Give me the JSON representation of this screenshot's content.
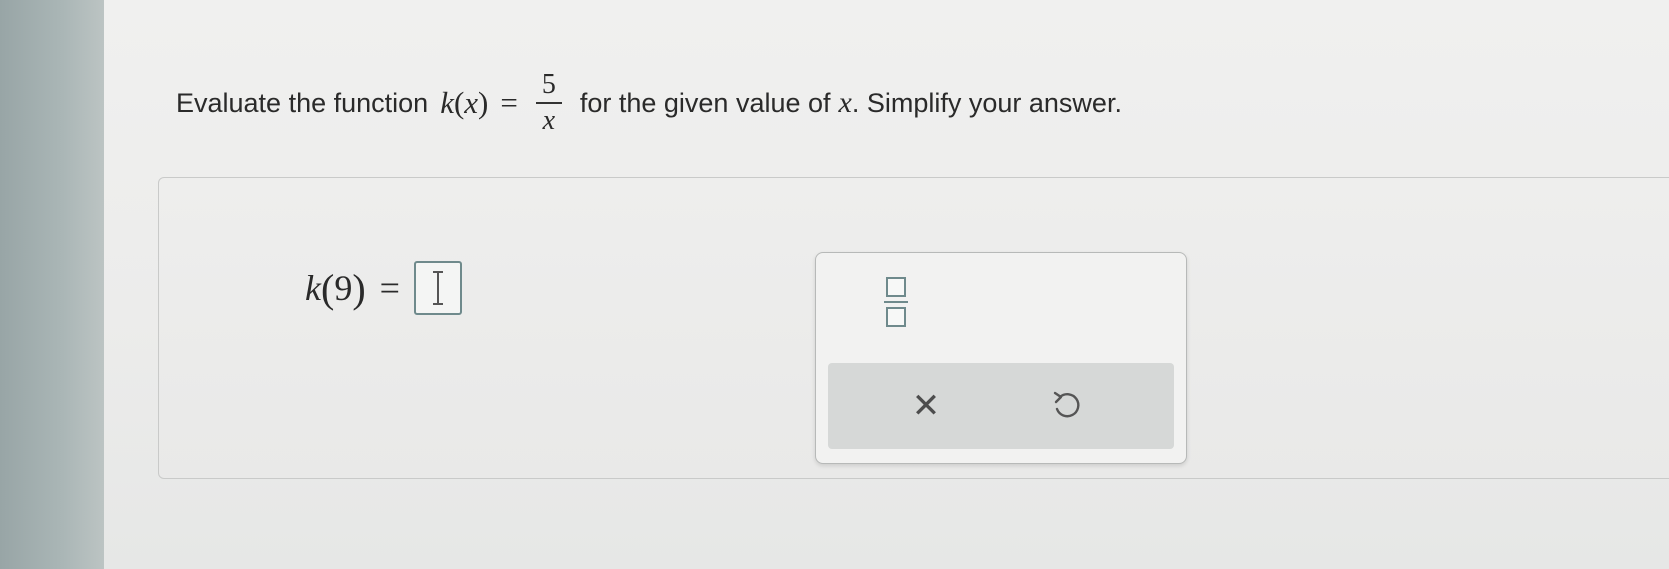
{
  "question": {
    "intro": "Evaluate the function",
    "func_name": "k",
    "func_var": "x",
    "numerator": "5",
    "denominator": "x",
    "middle": "for the given value of",
    "var": "x",
    "end": ". Simplify your answer."
  },
  "answer": {
    "func_name": "k",
    "arg": "9",
    "value": ""
  },
  "palette": {
    "fraction_icon": "fraction-template-icon",
    "clear_icon": "close-icon",
    "clear_symbol": "✕",
    "undo_icon": "undo-icon"
  },
  "colors": {
    "input_border": "#6f8a8c",
    "action_bar": "#d6d8d7"
  }
}
